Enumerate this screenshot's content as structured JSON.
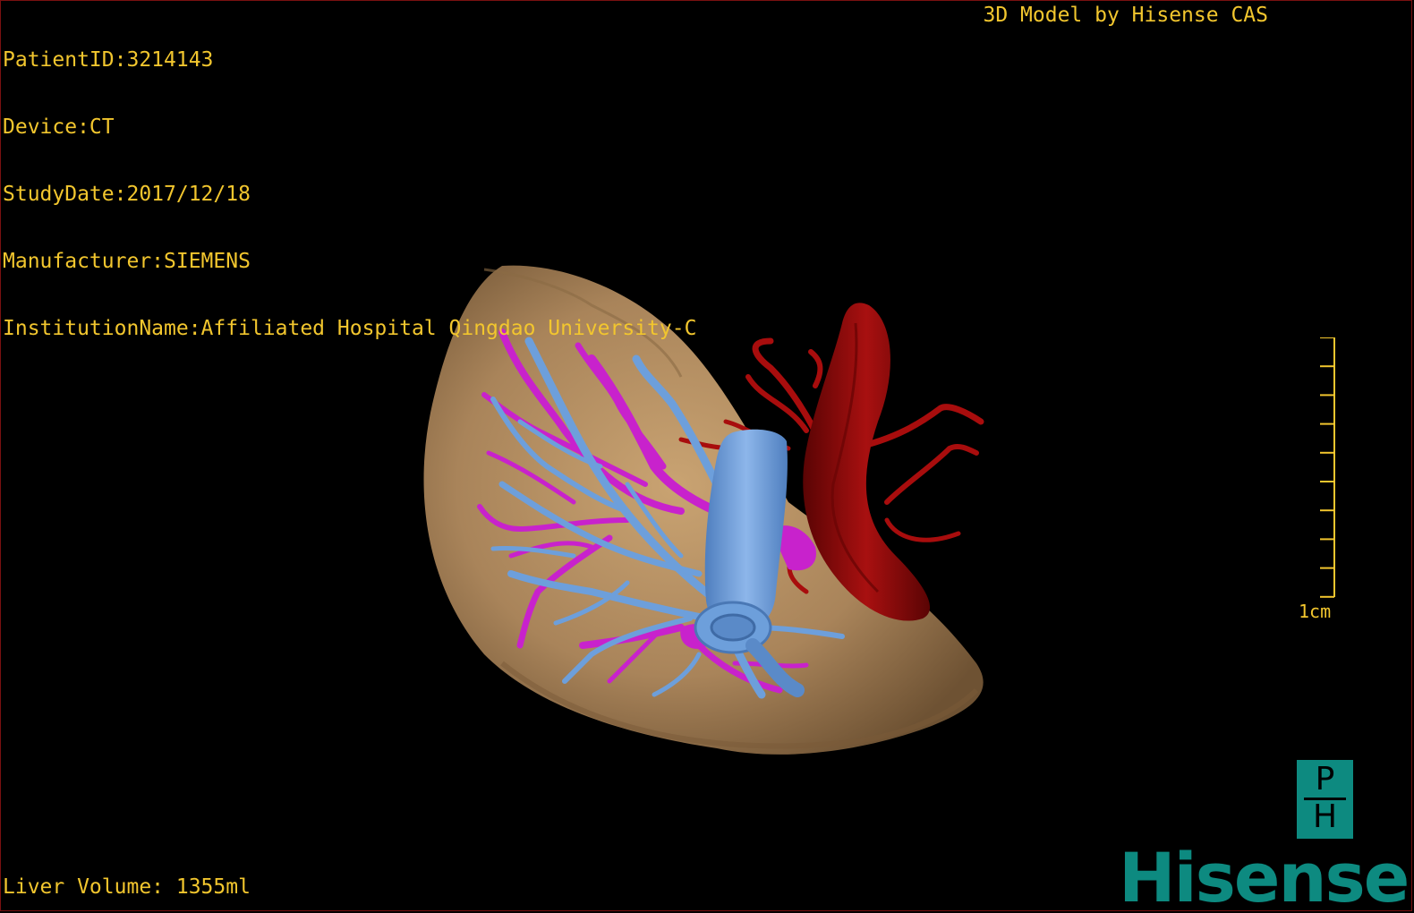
{
  "overlay": {
    "patient_id": "PatientID:3214143",
    "device": "Device:CT",
    "study_date": "StudyDate:2017/12/18",
    "manufacturer": "Manufacturer:SIEMENS",
    "institution": "InstitutionName:Affiliated Hospital Qingdao University-C",
    "model_credit": "3D Model by Hisense CAS",
    "liver_volume": "Liver Volume: 1355ml"
  },
  "scale": {
    "label": "1cm"
  },
  "logo": {
    "ph_top": "P",
    "ph_bottom": "H",
    "brand": "Hisense"
  },
  "colors": {
    "text": "#f2c62e",
    "liver": "#b08b5c",
    "portal_vein": "#6b9bd6",
    "hepatic_vein": "#c026c8",
    "artery": "#9c0a0a",
    "brand": "#0d8a80"
  }
}
